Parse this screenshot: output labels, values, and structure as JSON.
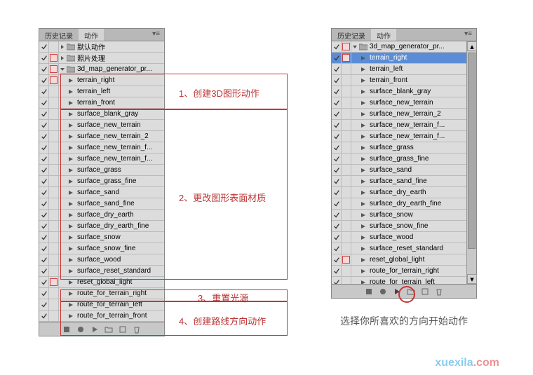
{
  "tabs": {
    "history": "历史记录",
    "actions": "动作"
  },
  "panel1": {
    "rows": [
      {
        "chk": true,
        "sq": false,
        "exp": "r",
        "folder": true,
        "label": "默认动作",
        "indent": 0
      },
      {
        "chk": true,
        "sq": true,
        "exp": "r",
        "folder": true,
        "label": "照片处理",
        "indent": 0
      },
      {
        "chk": true,
        "sq": true,
        "exp": "d",
        "folder": true,
        "label": "3d_map_generator_pr...",
        "indent": 0
      },
      {
        "chk": true,
        "sq": true,
        "exp": "",
        "play": true,
        "label": "terrain_right",
        "indent": 1
      },
      {
        "chk": true,
        "sq": false,
        "exp": "",
        "play": true,
        "label": "terrain_left",
        "indent": 1
      },
      {
        "chk": true,
        "sq": false,
        "exp": "",
        "play": true,
        "label": "terrain_front",
        "indent": 1
      },
      {
        "chk": true,
        "sq": false,
        "exp": "",
        "play": true,
        "label": "surface_blank_gray",
        "indent": 1
      },
      {
        "chk": true,
        "sq": false,
        "exp": "",
        "play": true,
        "label": "surface_new_terrain",
        "indent": 1
      },
      {
        "chk": true,
        "sq": false,
        "exp": "",
        "play": true,
        "label": "surface_new_terrain_2",
        "indent": 1
      },
      {
        "chk": true,
        "sq": false,
        "exp": "",
        "play": true,
        "label": "surface_new_terrain_f...",
        "indent": 1
      },
      {
        "chk": true,
        "sq": false,
        "exp": "",
        "play": true,
        "label": "surface_new_terrain_f...",
        "indent": 1
      },
      {
        "chk": true,
        "sq": false,
        "exp": "",
        "play": true,
        "label": "surface_grass",
        "indent": 1
      },
      {
        "chk": true,
        "sq": false,
        "exp": "",
        "play": true,
        "label": "surface_grass_fine",
        "indent": 1
      },
      {
        "chk": true,
        "sq": false,
        "exp": "",
        "play": true,
        "label": "surface_sand",
        "indent": 1
      },
      {
        "chk": true,
        "sq": false,
        "exp": "",
        "play": true,
        "label": "surface_sand_fine",
        "indent": 1
      },
      {
        "chk": true,
        "sq": false,
        "exp": "",
        "play": true,
        "label": "surface_dry_earth",
        "indent": 1
      },
      {
        "chk": true,
        "sq": false,
        "exp": "",
        "play": true,
        "label": "surface_dry_earth_fine",
        "indent": 1
      },
      {
        "chk": true,
        "sq": false,
        "exp": "",
        "play": true,
        "label": "surface_snow",
        "indent": 1
      },
      {
        "chk": true,
        "sq": false,
        "exp": "",
        "play": true,
        "label": "surface_snow_fine",
        "indent": 1
      },
      {
        "chk": true,
        "sq": false,
        "exp": "",
        "play": true,
        "label": "surface_wood",
        "indent": 1
      },
      {
        "chk": true,
        "sq": false,
        "exp": "",
        "play": true,
        "label": "surface_reset_standard",
        "indent": 1
      },
      {
        "chk": true,
        "sq": true,
        "exp": "",
        "play": true,
        "label": "reset_global_light",
        "indent": 1
      },
      {
        "chk": true,
        "sq": false,
        "exp": "",
        "play": true,
        "label": "route_for_terrain_right",
        "indent": 1
      },
      {
        "chk": true,
        "sq": false,
        "exp": "",
        "play": true,
        "label": "route_for_terrain_left",
        "indent": 1
      },
      {
        "chk": true,
        "sq": false,
        "exp": "",
        "play": true,
        "label": "route_for_terrain_front",
        "indent": 1
      }
    ]
  },
  "panel2": {
    "rows": [
      {
        "chk": true,
        "sq": true,
        "exp": "d",
        "folder": true,
        "label": "3d_map_generator_pr...",
        "indent": 0
      },
      {
        "chk": true,
        "sq": true,
        "exp": "",
        "play": true,
        "label": "terrain_right",
        "indent": 1,
        "sel": true
      },
      {
        "chk": true,
        "sq": false,
        "exp": "",
        "play": true,
        "label": "terrain_left",
        "indent": 1
      },
      {
        "chk": true,
        "sq": false,
        "exp": "",
        "play": true,
        "label": "terrain_front",
        "indent": 1
      },
      {
        "chk": true,
        "sq": false,
        "exp": "",
        "play": true,
        "label": "surface_blank_gray",
        "indent": 1
      },
      {
        "chk": true,
        "sq": false,
        "exp": "",
        "play": true,
        "label": "surface_new_terrain",
        "indent": 1
      },
      {
        "chk": true,
        "sq": false,
        "exp": "",
        "play": true,
        "label": "surface_new_terrain_2",
        "indent": 1
      },
      {
        "chk": true,
        "sq": false,
        "exp": "",
        "play": true,
        "label": "surface_new_terrain_f...",
        "indent": 1
      },
      {
        "chk": true,
        "sq": false,
        "exp": "",
        "play": true,
        "label": "surface_new_terrain_f...",
        "indent": 1
      },
      {
        "chk": true,
        "sq": false,
        "exp": "",
        "play": true,
        "label": "surface_grass",
        "indent": 1
      },
      {
        "chk": true,
        "sq": false,
        "exp": "",
        "play": true,
        "label": "surface_grass_fine",
        "indent": 1
      },
      {
        "chk": true,
        "sq": false,
        "exp": "",
        "play": true,
        "label": "surface_sand",
        "indent": 1
      },
      {
        "chk": true,
        "sq": false,
        "exp": "",
        "play": true,
        "label": "surface_sand_fine",
        "indent": 1
      },
      {
        "chk": true,
        "sq": false,
        "exp": "",
        "play": true,
        "label": "surface_dry_earth",
        "indent": 1
      },
      {
        "chk": true,
        "sq": false,
        "exp": "",
        "play": true,
        "label": "surface_dry_earth_fine",
        "indent": 1
      },
      {
        "chk": true,
        "sq": false,
        "exp": "",
        "play": true,
        "label": "surface_snow",
        "indent": 1
      },
      {
        "chk": true,
        "sq": false,
        "exp": "",
        "play": true,
        "label": "surface_snow_fine",
        "indent": 1
      },
      {
        "chk": true,
        "sq": false,
        "exp": "",
        "play": true,
        "label": "surface_wood",
        "indent": 1
      },
      {
        "chk": true,
        "sq": false,
        "exp": "",
        "play": true,
        "label": "surface_reset_standard",
        "indent": 1
      },
      {
        "chk": true,
        "sq": true,
        "exp": "",
        "play": true,
        "label": "reset_global_light",
        "indent": 1
      },
      {
        "chk": true,
        "sq": false,
        "exp": "",
        "play": true,
        "label": "route_for_terrain_right",
        "indent": 1
      },
      {
        "chk": true,
        "sq": false,
        "exp": "",
        "play": true,
        "label": "route_for_terrain_left",
        "indent": 1
      }
    ]
  },
  "annotations": {
    "a1": "1、创建3D图形动作",
    "a2": "2、更改图形表面材质",
    "a3": "3、重置光源",
    "a4": "4、创建路线方向动作"
  },
  "caption": "选择你所喜欢的方向开始动作",
  "watermark": {
    "part1": "xuexila",
    "part2": ".com"
  }
}
